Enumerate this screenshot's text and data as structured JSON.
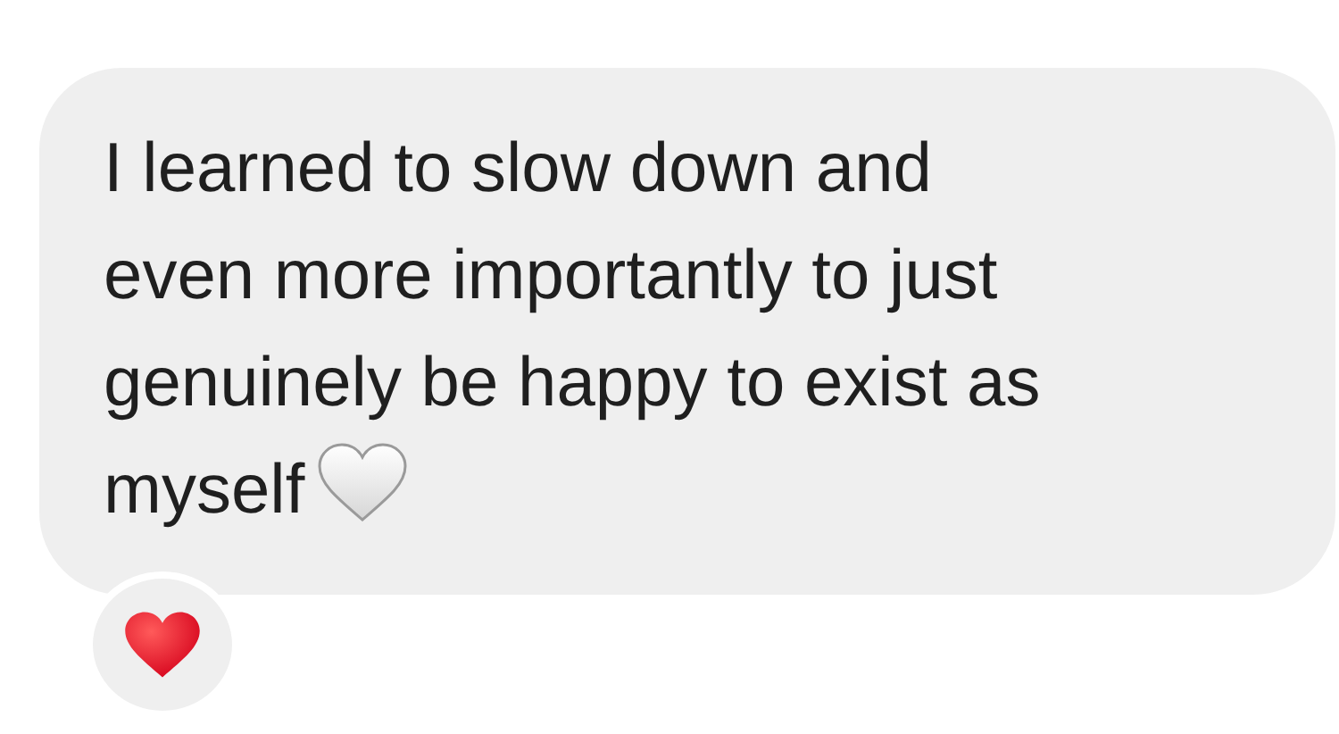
{
  "message": {
    "lines": [
      "I learned to slow down and",
      "even more importantly to just",
      "genuinely be happy to exist as",
      "myself"
    ]
  },
  "reaction": {
    "kind": "heart"
  }
}
